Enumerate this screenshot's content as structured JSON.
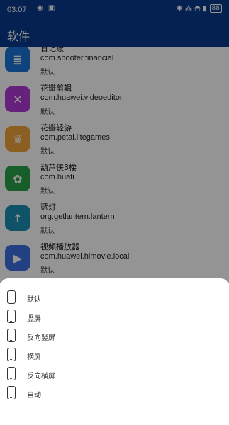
{
  "status_bar": {
    "time": "03:07",
    "left_icons": "◉ ▣",
    "right_icons": "✱ ⁂ ◓ ▮",
    "battery": "88"
  },
  "app_bar": {
    "title": "软件"
  },
  "apps": [
    {
      "name": "日记账",
      "package": "com.shooter.financial",
      "mode": "默认",
      "icon": "journal-app-icon",
      "icon_glyph": "≣",
      "color": "#1a74d8"
    },
    {
      "name": "花瓣剪辑",
      "package": "com.huawei.videoeditor",
      "mode": "默认",
      "icon": "video-editor-app-icon",
      "icon_glyph": "✕",
      "color": "#b03ad6"
    },
    {
      "name": "花瓣轻游",
      "package": "com.petal.litegames",
      "mode": "默认",
      "icon": "games-app-icon",
      "icon_glyph": "♛",
      "color": "#f0a43c"
    },
    {
      "name": "葫芦侠3楼",
      "package": "com.huati",
      "mode": "默认",
      "icon": "gourd-app-icon",
      "icon_glyph": "✿",
      "color": "#2aa34a"
    },
    {
      "name": "蓝灯",
      "package": "org.getlantern.lantern",
      "mode": "默认",
      "icon": "lantern-app-icon",
      "icon_glyph": "↑",
      "color": "#1d8fb5"
    },
    {
      "name": "视频播放器",
      "package": "com.huawei.himovie.local",
      "mode": "默认",
      "icon": "video-player-app-icon",
      "icon_glyph": "▶",
      "color": "#3b6fe0"
    }
  ],
  "orientation_options": [
    {
      "label": "默认"
    },
    {
      "label": "竖屏"
    },
    {
      "label": "反向竖屏"
    },
    {
      "label": "横屏"
    },
    {
      "label": "反向横屏"
    },
    {
      "label": "自动"
    }
  ]
}
